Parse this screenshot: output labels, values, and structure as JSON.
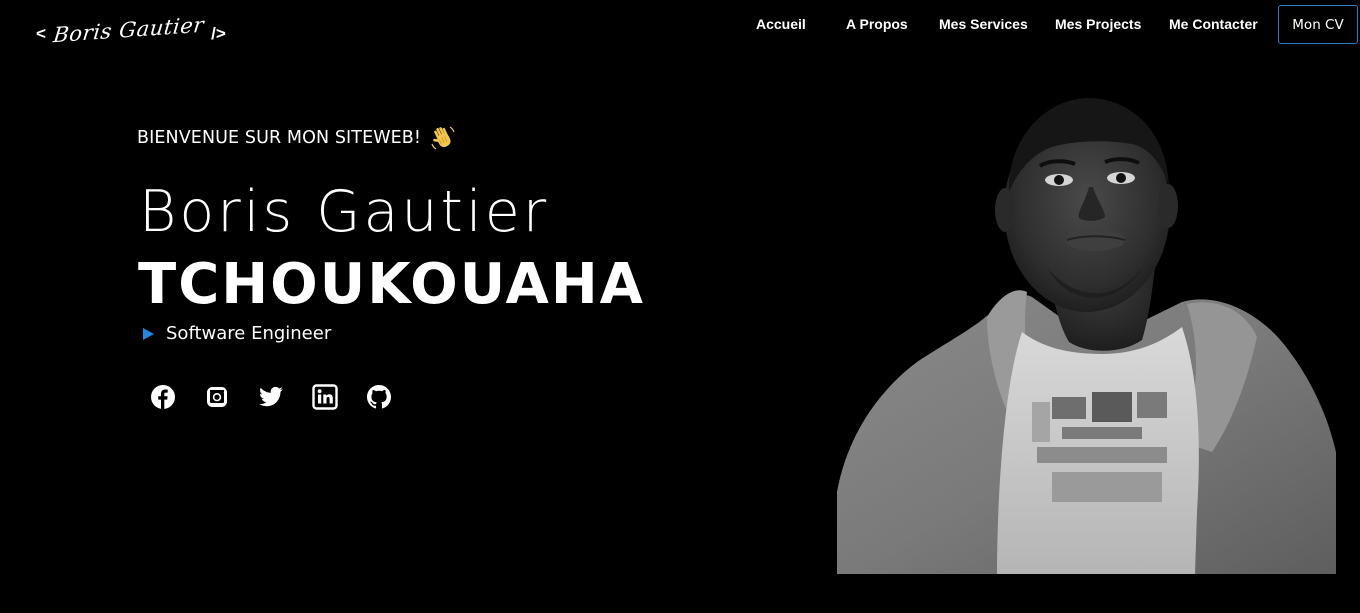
{
  "header": {
    "logo": {
      "open_bracket": "<",
      "script_name": "Boris Gautier",
      "close_bracket": "/>"
    },
    "nav": [
      {
        "label": "Accueil"
      },
      {
        "label": "A Propos"
      },
      {
        "label": "Mes Services"
      },
      {
        "label": "Mes Projects"
      },
      {
        "label": "Me Contacter"
      }
    ],
    "cv_button": "Mon CV"
  },
  "hero": {
    "welcome": "BIENVENUE SUR MON SITEWEB!",
    "first_name": "Boris Gautier",
    "last_name": "TCHOUKOUAHA",
    "role": "Software Engineer",
    "role_marker_color": "#1e88e5"
  },
  "socials": [
    {
      "icon": "facebook-icon"
    },
    {
      "icon": "instagram-icon"
    },
    {
      "icon": "twitter-icon"
    },
    {
      "icon": "linkedin-icon"
    },
    {
      "icon": "github-icon"
    }
  ],
  "colors": {
    "background": "#000000",
    "text": "#ffffff",
    "accent": "#2f7fc7"
  }
}
